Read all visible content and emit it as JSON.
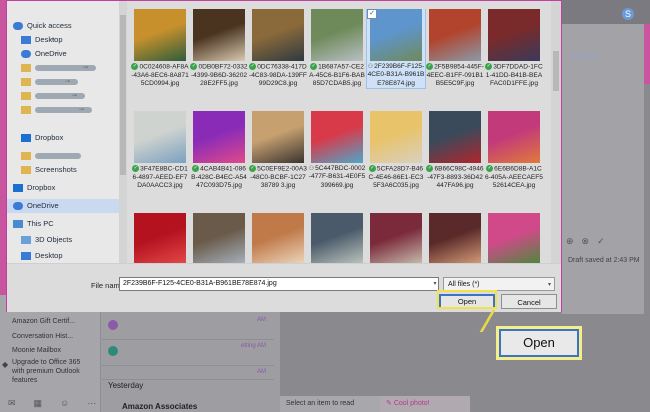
{
  "sidebar": {
    "items": [
      {
        "label": "Quick access",
        "icon": "star-icon",
        "pinned": false
      },
      {
        "label": "Desktop",
        "icon": "folder-blue-icon",
        "pinned": true
      },
      {
        "label": "OneDrive",
        "icon": "cloud-icon",
        "pinned": true
      },
      {
        "label": "",
        "icon": "folder-icon",
        "pinned": true
      },
      {
        "label": "",
        "icon": "folder-icon",
        "pinned": true
      },
      {
        "label": "",
        "icon": "folder-icon",
        "pinned": true
      },
      {
        "label": "",
        "icon": "folder-icon",
        "pinned": true
      },
      {
        "label": "Dropbox",
        "icon": "dropbox-icon",
        "pinned": false
      },
      {
        "label": "",
        "icon": "folder-icon",
        "pinned": false
      },
      {
        "label": "Screenshots",
        "icon": "folder-icon",
        "pinned": false
      },
      {
        "label": "Dropbox",
        "icon": "dropbox-icon",
        "pinned": false
      },
      {
        "label": "OneDrive",
        "icon": "cloud-icon",
        "pinned": false
      },
      {
        "label": "This PC",
        "icon": "computer-icon",
        "pinned": false
      },
      {
        "label": "3D Objects",
        "icon": "cube-icon",
        "pinned": false
      },
      {
        "label": "Desktop",
        "icon": "folder-blue-icon",
        "pinned": false
      }
    ],
    "selected_index": 11
  },
  "files": [
    {
      "name": "0C024608-AF8A-43A6-8EC6-8A8715CD0994.jpg",
      "status": "synced",
      "colors": [
        "#c7902c",
        "#2e5d3c"
      ]
    },
    {
      "name": "0DB0BF72-0332-4399-9B6D-3620228E2FF5.jpg",
      "status": "synced",
      "colors": [
        "#4a3420",
        "#d9c9b0"
      ]
    },
    {
      "name": "0DC76338-417D-4C83-98DA-139FF99D29C8.jpg",
      "status": "synced",
      "colors": [
        "#8a6a3a",
        "#2f3a40"
      ]
    },
    {
      "name": "1B687A57-CE2A-45C6-B1F6-BAB85D7CDAB5.jpg",
      "status": "synced",
      "colors": [
        "#6f8a5a",
        "#b7c0c4"
      ]
    },
    {
      "name": "2F239B6F-F125-4CE0-B31A-B961BE78E874.jpg",
      "status": "user",
      "colors": [
        "#5e95cc",
        "#6f8a5a"
      ],
      "selected": true
    },
    {
      "name": "2F5B9854-445F-4EEC-B1FF-091B1B5E5C9F.jpg",
      "status": "synced",
      "colors": [
        "#b2432c",
        "#8a9aa8"
      ]
    },
    {
      "name": "3DF7DDAD-1FC1-41DD-B41B-BEAFAC0D1FFE.jpg",
      "status": "synced",
      "colors": [
        "#7a2a2a",
        "#3a3a5a"
      ]
    },
    {
      "name": "3F47E8BC-CD16-4897-AEED-EF7DA0AACC3.jpg",
      "status": "synced",
      "colors": [
        "#cfd3cf",
        "#7aa0c0"
      ]
    },
    {
      "name": "4CAB4B41-086B-428C-B4EC-A5447C093D75.jpg",
      "status": "synced",
      "colors": [
        "#8a2bb8",
        "#e04a8a"
      ]
    },
    {
      "name": "5C0EF9E2-00A3-48C0-BCBF-1C2738789 3.jpg",
      "status": "synced",
      "colors": [
        "#c7a070",
        "#3a3430"
      ]
    },
    {
      "name": "5C447BDC-0002-477F-B631-4E0F5399669.jpg",
      "status": "user",
      "colors": [
        "#d83a4a",
        "#4fa7c9"
      ]
    },
    {
      "name": "5CFA28D7-B46C-4E46-86E1-EC35F3A6C035.jpg",
      "status": "synced",
      "colors": [
        "#e8c36a",
        "#d9d0c0"
      ]
    },
    {
      "name": "6B66C98C-4946-47F3-8893-36D42447FA96.jpg",
      "status": "synced",
      "colors": [
        "#3a4a5a",
        "#b1262e"
      ]
    },
    {
      "name": "6E6B6D8B-A1C6-405A-AEECAEF552614CEA.jpg",
      "status": "synced",
      "colors": [
        "#c23a7a",
        "#e07a3a"
      ]
    },
    {
      "name": "",
      "status": "none",
      "colors": [
        "#b3121e",
        "#e54a4a"
      ]
    },
    {
      "name": "",
      "status": "none",
      "colors": [
        "#6a5a4a",
        "#a8b4c0"
      ]
    },
    {
      "name": "",
      "status": "none",
      "colors": [
        "#c07a4a",
        "#ecd8c0"
      ]
    },
    {
      "name": "",
      "status": "none",
      "colors": [
        "#4a5a6a",
        "#c0c8c0"
      ]
    },
    {
      "name": "",
      "status": "none",
      "colors": [
        "#7a2a3a",
        "#c8c0b0"
      ]
    },
    {
      "name": "",
      "status": "none",
      "colors": [
        "#5a2a2a",
        "#d9a07a"
      ]
    },
    {
      "name": "",
      "status": "none",
      "colors": [
        "#d04a8a",
        "#4a8a3a"
      ]
    }
  ],
  "dialog": {
    "filename_label": "File name:",
    "filename_value": "2F239B6F-F125-4CE0-B31A-B961BE78E874.jpg",
    "filetype": "All files (*)",
    "open_label": "Open",
    "cancel_label": "Cancel"
  },
  "callout": {
    "label": "Open",
    "highlight_color": "#f5ee86"
  },
  "background": {
    "cc_bcc": "Cc  Bcc",
    "draft": "Draft saved at 2:43 PM",
    "nav_items": [
      "Amazon Gift Certif...",
      "Conversation Hist...",
      "Moonie Mailbox"
    ],
    "upgrade": "Upgrade to Office 365 with premium Outlook features",
    "times": [
      "AM",
      "etting AM",
      "AM"
    ],
    "yesterday": "Yesterday",
    "amazon": "Amazon Associates",
    "read": "Select an item to read",
    "cool": "Cool photo!"
  }
}
